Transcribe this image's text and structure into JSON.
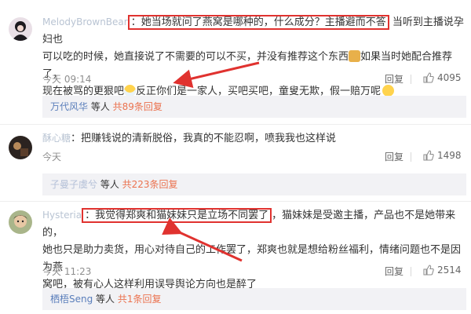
{
  "comments": [
    {
      "username": "MelodyBrownBear",
      "highlighted": "：她当场就问了燕窝是哪种的，什么成分？主播避而不答",
      "line1_rest": "当听到主播说孕妇也",
      "line2a": "可以吃的时候，她直接说了不需要的可以不买，并没有推荐这个东西",
      "line2b": "如果当时她配合推荐了，",
      "line3a": "现在被骂的更狠吧",
      "line3b": "反正你们是一家人，买吧买吧，童叟无欺，假一赔万呢",
      "time": "今天 09:14",
      "reply_label": "回复",
      "likes": "4095",
      "reply_summary": {
        "user": "万代风华",
        "middle": " 等人 ",
        "count": "共89条回复"
      }
    },
    {
      "username": "酥心糖",
      "text": "：把赚钱说的清新脱俗，我真的不能忍啊，喷我我也这样说",
      "time": "今天",
      "reply_label": "回复",
      "likes": "1498",
      "reply_summary": {
        "user": "子曼子虞兮",
        "middle": " 等人 ",
        "count": "共223条回复"
      }
    },
    {
      "username": "Hysteria",
      "highlighted": "：我觉得郑爽和猫妹妹只是立场不同罢了",
      "line1_rest": "，猫妹妹是受邀主播，产品也不是她带来的，",
      "line2": "她也只是助力卖货，用心对待自己的工作罢了，郑爽也就是想给粉丝福利，情绪问题也不是因为燕",
      "line3": "窝吧，被有心人这样利用误导舆论方向也是醉了",
      "time": "今天 11:23",
      "reply_label": "回复",
      "likes": "2514",
      "reply_summary": {
        "user": "栖梧Seng",
        "middle": " 等人 ",
        "count": "共1条回复"
      }
    }
  ],
  "icons": {
    "like": "thumbs-up-icon",
    "emoji_hands": "clap-hands-emoji-icon",
    "emoji_mask": "mask-face-emoji-icon",
    "emoji_smirk": "smirk-face-emoji-icon"
  },
  "colors": {
    "highlight_border": "#e0322f",
    "link_orange": "#eb7350",
    "name_blue": "#5a7ebb",
    "reply_bg": "#f2f2f5"
  }
}
